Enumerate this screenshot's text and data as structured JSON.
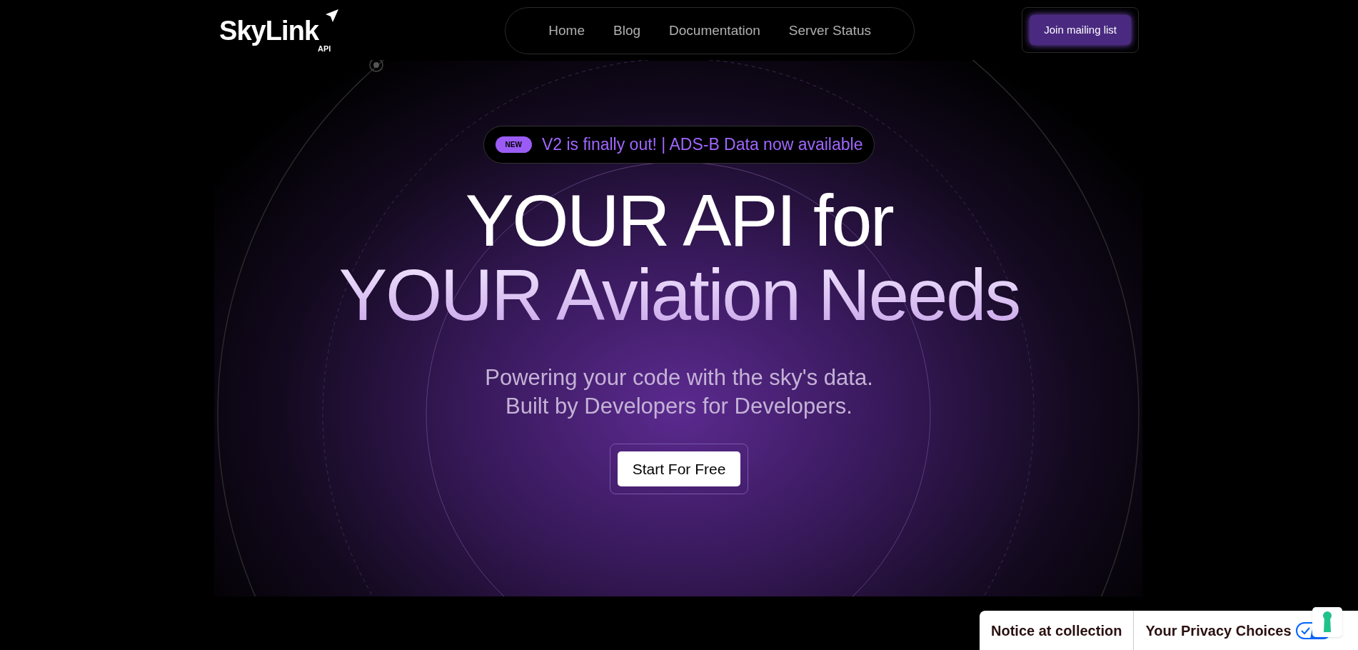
{
  "logo": {
    "name": "SkyLink",
    "sub": "API"
  },
  "nav": [
    {
      "label": "Home"
    },
    {
      "label": "Blog"
    },
    {
      "label": "Documentation"
    },
    {
      "label": "Server Status"
    }
  ],
  "mailing_button": "Join mailing list",
  "announcement": {
    "badge": "NEW",
    "text": "V2 is finally out! | ADS-B Data now available"
  },
  "headline": [
    "YOUR API for",
    "YOUR Aviation Needs"
  ],
  "subtitle": [
    "Powering your code with the sky's data.",
    "Built by Developers for Developers."
  ],
  "cta": "Start For Free",
  "privacy_bar": {
    "notice": "Notice at collection",
    "choices": "Your Privacy Choices"
  }
}
